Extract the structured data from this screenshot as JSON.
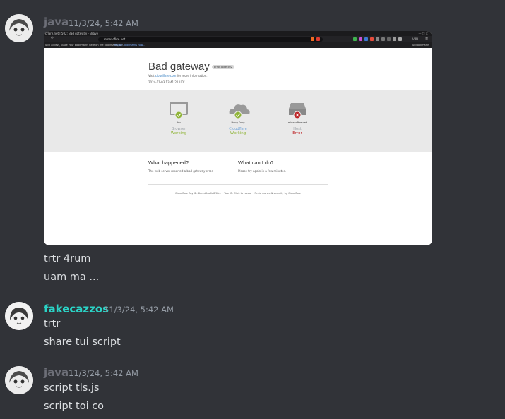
{
  "messages": [
    {
      "username": "java",
      "timestamp": "11/3/24, 5:42 AM",
      "name_color": "#6d6f78",
      "lines": [
        "trtr 4rum",
        "uam ma ..."
      ]
    },
    {
      "username": "fakecazzos",
      "timestamp": "11/3/24, 5:42 AM",
      "name_color": "#2bd3c6",
      "lines": [
        "trtr",
        "share tui script"
      ]
    },
    {
      "username": "java",
      "timestamp": "11/3/24, 5:42 AM",
      "name_color": "#6d6f78",
      "lines": [
        "script tls.js",
        "script toi co"
      ]
    }
  ],
  "screenshot": {
    "tab_title": "cflare.net | 502: Bad gateway - Brave",
    "url": "mineacfkre.net",
    "bookmarks_hint": "uick access, place your bookmarks here on the bookmarks bar.",
    "bookmarks_link": "Import bookmarks now...",
    "all_bookmarks": "All Bookmarks",
    "vpn": "VPN",
    "title": "Bad gateway",
    "error_code": "Error code 502",
    "visit_prefix": "Visit",
    "visit_link": "cloudflare.com",
    "visit_suffix": "for more information.",
    "timestamp": "2024-11-03 13:41:21 UTC",
    "columns": [
      {
        "name": "You",
        "label": "Browser",
        "status": "Working",
        "status_color": "#8fb436"
      },
      {
        "name": "Hong Kong",
        "label": "Cloudflare",
        "status": "Working",
        "status_color": "#8fb436"
      },
      {
        "name": "mineacfkre.net",
        "label": "Host",
        "status": "Error",
        "status_color": "#bd2426"
      }
    ],
    "what_happened_title": "What happened?",
    "what_happened_text": "The web server reported a bad gateway error.",
    "what_can_title": "What can I do?",
    "what_can_text": "Please try again in a few minutes.",
    "footer": "Cloudflare Ray ID: 8dccd5ae0a8f6fcc • Your IP: Click to reveal • Performance & security by Cloudflare"
  }
}
